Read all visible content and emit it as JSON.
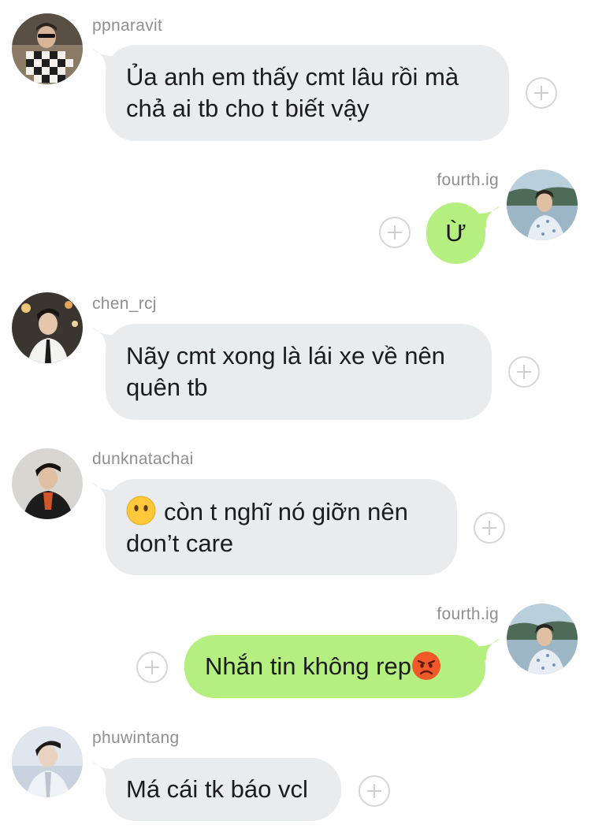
{
  "messages": [
    {
      "username": "ppnaravit",
      "text": "Ủa anh em thấy cmt lâu rồi mà chả ai tb cho t biết vậy",
      "avatar": "avatar-ppnaravit"
    },
    {
      "username": "fourth.ig",
      "text": "Ừ",
      "avatar": "avatar-fourth"
    },
    {
      "username": "chen_rcj",
      "text": "Nãy cmt xong là lái xe về nên quên tb",
      "avatar": "avatar-chen"
    },
    {
      "username": "dunknatachai",
      "emoji": "neutral-face-emoji",
      "text": "còn t nghĩ nó giỡn nên don’t care",
      "avatar": "avatar-dunk"
    },
    {
      "username": "fourth.ig",
      "text": "Nhắn tin không rep",
      "emoji": "angry-face-emoji",
      "avatar": "avatar-fourth"
    },
    {
      "username": "phuwintang",
      "text": "Má cái tk báo vcl",
      "avatar": "avatar-phuwin"
    }
  ],
  "colors": {
    "incoming_bubble": "#e9ecef",
    "outgoing_bubble": "#b5ef80",
    "username_text": "#8e8e93",
    "add_reaction_icon": "#cfcfd3"
  },
  "icons": {
    "add_reaction": "plus-circle-icon"
  }
}
